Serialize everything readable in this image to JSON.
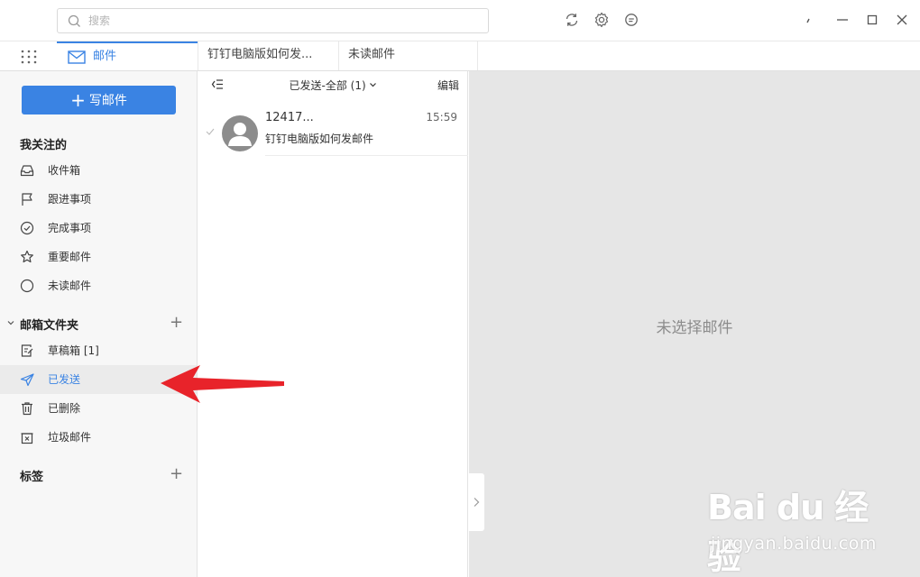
{
  "search": {
    "placeholder": "搜索"
  },
  "titlebar": {
    "icons": [
      "refresh-icon",
      "settings-icon",
      "chat-icon"
    ],
    "window_controls": [
      "pin-icon",
      "minimize-icon",
      "maximize-icon",
      "close-icon"
    ]
  },
  "tabs": [
    {
      "label": "邮件",
      "icon": "mail-icon",
      "active": true
    },
    {
      "label": "钉钉电脑版如何发..."
    },
    {
      "label": "未读邮件"
    }
  ],
  "sidebar": {
    "compose_label": "写邮件",
    "section_following": "我关注的",
    "following_items": [
      {
        "label": "收件箱",
        "icon": "inbox-icon"
      },
      {
        "label": "跟进事项",
        "icon": "flag-icon"
      },
      {
        "label": "完成事项",
        "icon": "check-circle-icon"
      },
      {
        "label": "重要邮件",
        "icon": "star-icon"
      },
      {
        "label": "未读邮件",
        "icon": "circle-icon"
      }
    ],
    "section_folders": "邮箱文件夹",
    "folder_items": [
      {
        "label": "草稿箱 [1]",
        "icon": "draft-icon"
      },
      {
        "label": "已发送",
        "icon": "send-icon",
        "selected": true
      },
      {
        "label": "已删除",
        "icon": "trash-icon"
      },
      {
        "label": "垃圾邮件",
        "icon": "spam-icon"
      }
    ],
    "section_tags": "标签"
  },
  "list": {
    "title": "已发送-全部 (1)",
    "edit_label": "编辑",
    "emails": [
      {
        "sender": "12417...",
        "time": "15:59",
        "subject": "钉钉电脑版如何发邮件"
      }
    ]
  },
  "preview": {
    "empty_text": "未选择邮件"
  },
  "watermark": {
    "logo": "Bai du 经验",
    "url": "jingyan.baidu.com"
  },
  "colors": {
    "accent": "#3a83e3",
    "arrow": "#e8232a",
    "preview_bg": "#e6e6e6"
  }
}
